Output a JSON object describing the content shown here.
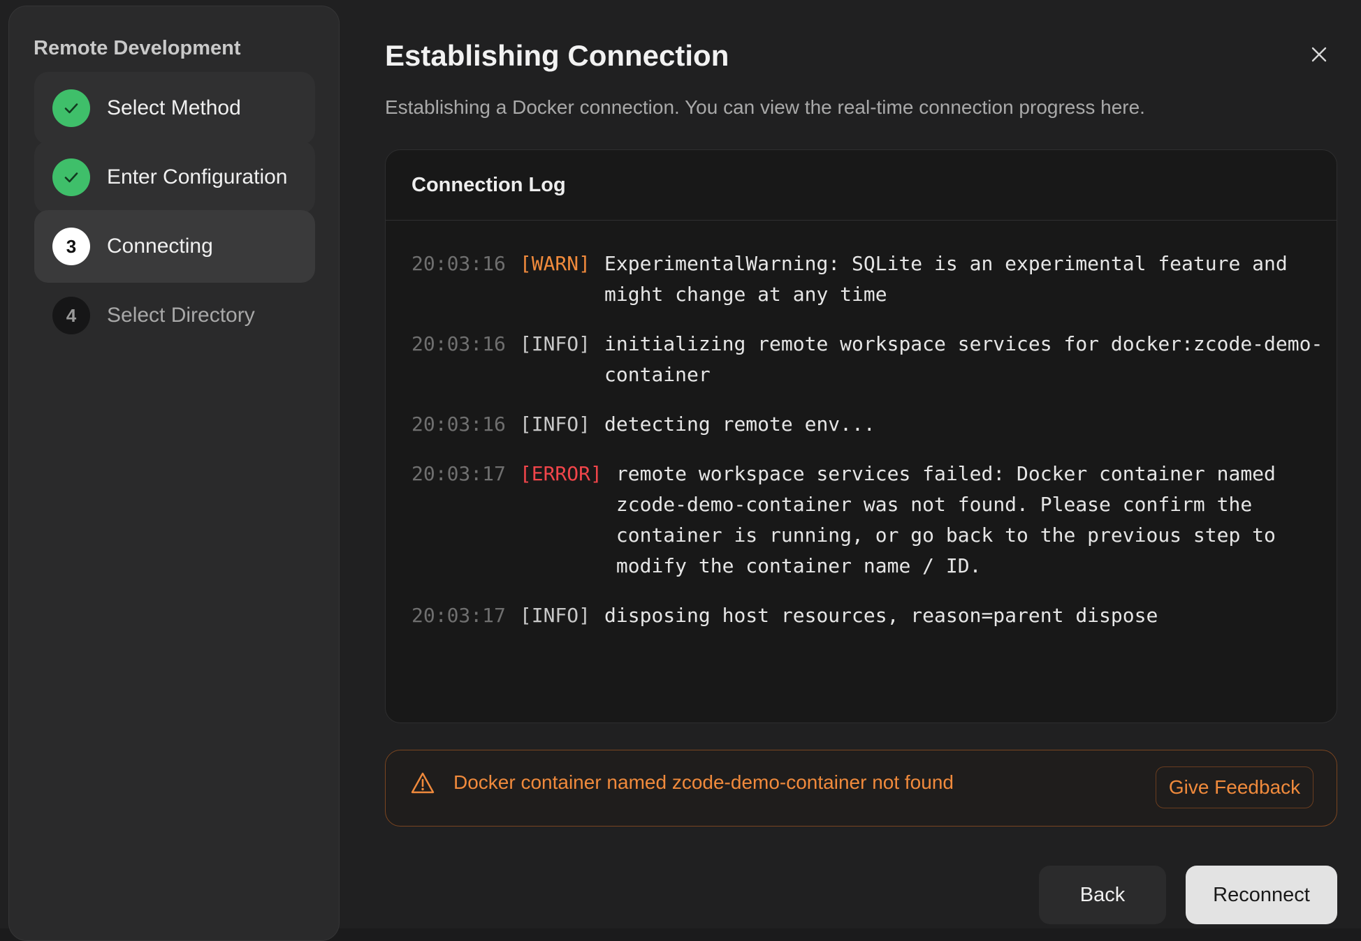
{
  "sidebar": {
    "title": "Remote Development",
    "steps": [
      {
        "label": "Select Method",
        "state": "done",
        "icon": "check-icon"
      },
      {
        "label": "Enter Configuration",
        "state": "done",
        "icon": "check-icon"
      },
      {
        "label": "Connecting",
        "state": "active",
        "number": "3"
      },
      {
        "label": "Select Directory",
        "state": "pending",
        "number": "4"
      }
    ]
  },
  "dialog": {
    "title": "Establishing Connection",
    "subtitle": "Establishing a Docker connection. You can view the real-time connection progress here.",
    "close_icon": "close-icon"
  },
  "log": {
    "title": "Connection Log",
    "entries": [
      {
        "time": "20:03:16",
        "level": "[WARN]",
        "message": "ExperimentalWarning: SQLite is an experimental feature and might change at any time"
      },
      {
        "time": "20:03:16",
        "level": "[INFO]",
        "message": "initializing remote workspace services for docker:zcode-demo-container"
      },
      {
        "time": "20:03:16",
        "level": "[INFO]",
        "message": "detecting remote env..."
      },
      {
        "time": "20:03:17",
        "level": "[ERROR]",
        "message": "remote workspace services failed: Docker container named zcode-demo-container was not found. Please confirm the container is running, or go back to the previous step to modify the container name / ID."
      },
      {
        "time": "20:03:17",
        "level": "[INFO]",
        "message": "disposing host resources, reason=parent dispose"
      }
    ]
  },
  "alert": {
    "icon": "warning-icon",
    "message": "Docker container named zcode-demo-container not found",
    "feedback_label": "Give Feedback"
  },
  "footer": {
    "back_label": "Back",
    "reconnect_label": "Reconnect"
  },
  "colors": {
    "success": "#3fbf6a",
    "warning": "#f08a3c",
    "error": "#f0454a"
  }
}
